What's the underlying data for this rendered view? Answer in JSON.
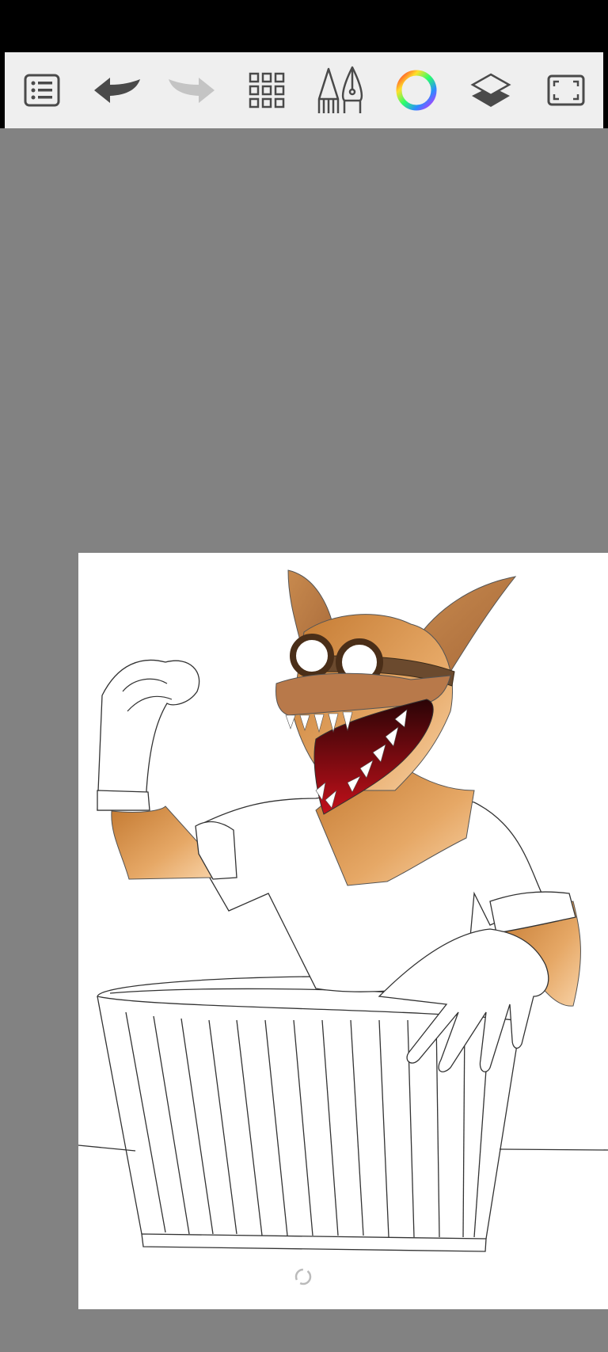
{
  "app": {
    "colors": {
      "toolbar_bg": "#efefef",
      "icon": "#4a4a4a",
      "icon_disabled": "#c4c4c4",
      "workspace": "#828282",
      "canvas": "#ffffff",
      "fur": "#cf8a46",
      "fur_light": "#f4c48f"
    }
  },
  "toolbar": {
    "tools": [
      {
        "id": "menu",
        "icon": "list-icon"
      },
      {
        "id": "undo",
        "icon": "undo-arrow-icon"
      },
      {
        "id": "redo",
        "icon": "redo-arrow-icon",
        "disabled": true
      },
      {
        "id": "grid",
        "icon": "grid-icon"
      },
      {
        "id": "brush",
        "icon": "pencil-pen-icon"
      },
      {
        "id": "color",
        "icon": "color-wheel-icon"
      },
      {
        "id": "layers",
        "icon": "layers-icon"
      },
      {
        "id": "fullscreen",
        "icon": "fullscreen-icon"
      }
    ]
  }
}
